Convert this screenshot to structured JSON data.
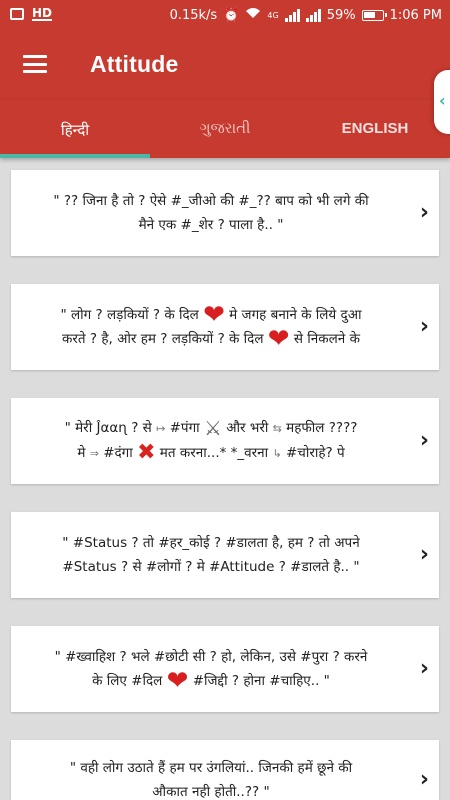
{
  "status_bar": {
    "left_badge": "HD",
    "speed": "0.15k/s",
    "network": "4G",
    "battery": "59%",
    "time": "1:06 PM"
  },
  "app_bar": {
    "title": "Attitude",
    "menu_icon": "hamburger-menu-icon"
  },
  "tabs": [
    {
      "label": "हिन्दी",
      "active": true
    },
    {
      "label": "ગુજરાતી",
      "active": false
    },
    {
      "label": "ENGLISH",
      "active": false
    }
  ],
  "side_handle_icon": "chevron-left-icon",
  "cards": [
    {
      "line1": "\" ?? जिना है तो ? ऐसे #_जीओ की #_?? बाप को भी लगे की",
      "line2": "मैने एक #_शेर ? पाला है.. \""
    },
    {
      "line1a": "\" लोग ? लड़कियों ? के दिल ",
      "line1b": " मे जगह बनाने के लिये दुआ",
      "line2a": "करते ? है, ओर हम ? लड़कियों ? के दिल ",
      "line2b": " से निकलने के"
    },
    {
      "line1a": "\" मेरी Ĵααɳ ? से ",
      "line1b": " #पंगा ",
      "line1c": " और भरी ",
      "line1d": " महफील ????",
      "line2a": "मे ",
      "line2b": " #दंगा ",
      "line2c": " मत करना...* *_वरना ",
      "line2d": " #चोराहे? पे"
    },
    {
      "line1": "\" #Status ? तो #हर_कोई ? #डालता है, हम ? तो अपने",
      "line2": "#Status ? से #लोगों ? मे #Attitude ? #डालते है.. \""
    },
    {
      "line1": "\" #ख्वाहिश ? भले #छोटी सी ? हो, लेकिन, उसे #पुरा ? करने",
      "line2a": "के लिए #दिल ",
      "line2b": " #जिद्दी ? होना #चाहिए.. \""
    },
    {
      "line1": "\" वही लोग उठाते हैं हम पर उंगलियां.. जिनकी हमें छूने की",
      "line2": "औकात नही होती..?? \""
    }
  ],
  "icons": {
    "heart": "heart-icon",
    "cross": "cross-mark-icon",
    "swords": "crossed-swords-icon",
    "chevron": "chevron-right-icon"
  },
  "colors": {
    "primary": "#c73a2f",
    "accent": "#4ab8a8",
    "background": "#dcdcdc"
  }
}
